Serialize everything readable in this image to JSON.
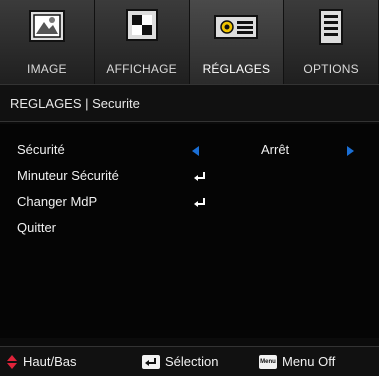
{
  "tabs": [
    {
      "label": "IMAGE",
      "icon": "image-icon",
      "active": false
    },
    {
      "label": "AFFICHAGE",
      "icon": "display-icon",
      "active": false
    },
    {
      "label": "RÉGLAGES",
      "icon": "projector-settings-icon",
      "active": true
    },
    {
      "label": "OPTIONS",
      "icon": "options-list-icon",
      "active": false
    }
  ],
  "breadcrumb": "REGLAGES | Securite",
  "menu": {
    "items": [
      {
        "label": "Sécurité",
        "value": "Arrêt",
        "control": "left-right-selector"
      },
      {
        "label": "Minuteur Sécurité",
        "control": "enter"
      },
      {
        "label": "Changer MdP",
        "control": "enter"
      },
      {
        "label": "Quitter",
        "control": "none"
      }
    ]
  },
  "footer": {
    "updown_label": "Haut/Bas",
    "select_label": "Sélection",
    "menu_chip": "Menu",
    "menu_label": "Menu Off"
  },
  "colors": {
    "arrow_blue": "#1a6fd6",
    "updown_red": "#e0233a",
    "background": "#0b0b0b"
  }
}
